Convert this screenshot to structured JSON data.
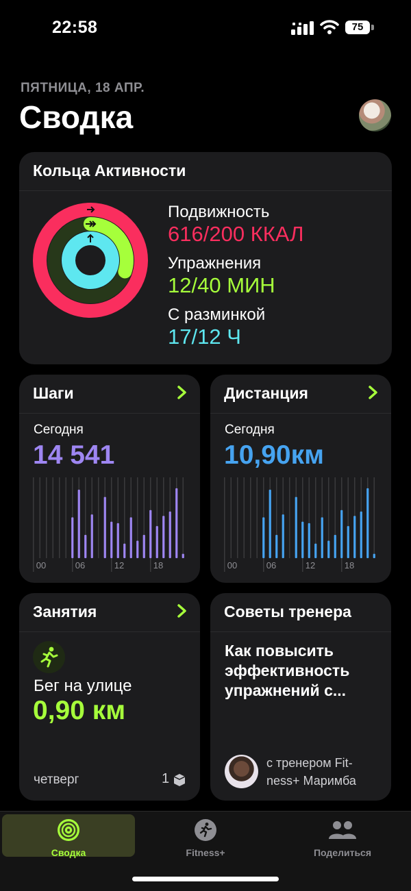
{
  "status_bar": {
    "time": "22:58",
    "battery": "75"
  },
  "header": {
    "date": "ПЯТНИЦА, 18 АПР.",
    "title": "Сводка"
  },
  "activity": {
    "title": "Кольца Активности",
    "move": {
      "label": "Подвижность",
      "value": "616/200 ККАЛ",
      "color": "#fa2e5e",
      "progress": 3.08
    },
    "exercise": {
      "label": "Упражнения",
      "value": "12/40 МИН",
      "color": "#a6ff3b",
      "progress": 0.3
    },
    "stand": {
      "label": "С разминкой",
      "value": "17/12 Ч",
      "color": "#5ee7f0",
      "progress": 1.42
    }
  },
  "steps": {
    "title": "Шаги",
    "today_label": "Сегодня",
    "value": "14 541",
    "color": "#9e86f2",
    "tick_labels": [
      "00",
      "06",
      "12",
      "18"
    ],
    "hourly": [
      0,
      0,
      0,
      0,
      0,
      0,
      0.28,
      0.47,
      0.16,
      0.3,
      0,
      0.42,
      0.25,
      0.24,
      0.1,
      0.28,
      0.12,
      0.16,
      0.33,
      0.22,
      0.29,
      0.32,
      0.48,
      0.03
    ]
  },
  "distance": {
    "title": "Дистанция",
    "today_label": "Сегодня",
    "value": "10,90км",
    "color": "#46a3f0",
    "tick_labels": [
      "00",
      "06",
      "12",
      "18"
    ],
    "hourly": [
      0,
      0,
      0,
      0,
      0,
      0,
      0.28,
      0.47,
      0.16,
      0.3,
      0,
      0.42,
      0.25,
      0.24,
      0.1,
      0.28,
      0.12,
      0.16,
      0.33,
      0.22,
      0.29,
      0.32,
      0.48,
      0.03
    ]
  },
  "workouts": {
    "title": "Занятия",
    "name": "Бег на улице",
    "distance": "0,90 км",
    "day": "четверг",
    "count": "1"
  },
  "tips": {
    "title": "Советы тренера",
    "text": "Как повысить эффективность упражнений с...",
    "trainer_line1": "с тренером Fit-",
    "trainer_line2": "ness+ Маримба"
  },
  "tabs": [
    {
      "label": "Сводка",
      "icon": "activity-rings-icon",
      "active": true
    },
    {
      "label": "Fitness+",
      "icon": "running-figure-icon",
      "active": false
    },
    {
      "label": "Поделиться",
      "icon": "people-icon",
      "active": false
    }
  ]
}
